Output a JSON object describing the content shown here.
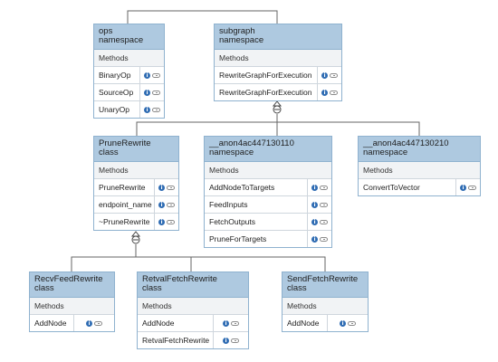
{
  "nodes": {
    "ops": {
      "title": "ops\nnamespace",
      "section": "Methods",
      "rows": [
        "BinaryOp",
        "SourceOp",
        "UnaryOp"
      ]
    },
    "subgraph": {
      "title": "subgraph\nnamespace",
      "section": "Methods",
      "rows": [
        "RewriteGraphForExecution",
        "RewriteGraphForExecution"
      ]
    },
    "prune": {
      "title": "PruneRewrite\nclass",
      "section": "Methods",
      "rows": [
        "PruneRewrite",
        "endpoint_name",
        "~PruneRewrite"
      ]
    },
    "anon110": {
      "title": "__anon4ac447130110\nnamespace",
      "section": "Methods",
      "rows": [
        "AddNodeToTargets",
        "FeedInputs",
        "FetchOutputs",
        "PruneForTargets"
      ]
    },
    "anon210": {
      "title": "__anon4ac447130210\nnamespace",
      "section": "Methods",
      "rows": [
        "ConvertToVector"
      ]
    },
    "recv": {
      "title": "RecvFeedRewrite\nclass",
      "section": "Methods",
      "rows": [
        "AddNode"
      ]
    },
    "retval": {
      "title": "RetvalFetchRewrite\nclass",
      "section": "Methods",
      "rows": [
        "AddNode",
        "RetvalFetchRewrite"
      ]
    },
    "send": {
      "title": "SendFetchRewrite\nclass",
      "section": "Methods",
      "rows": [
        "AddNode"
      ]
    }
  }
}
